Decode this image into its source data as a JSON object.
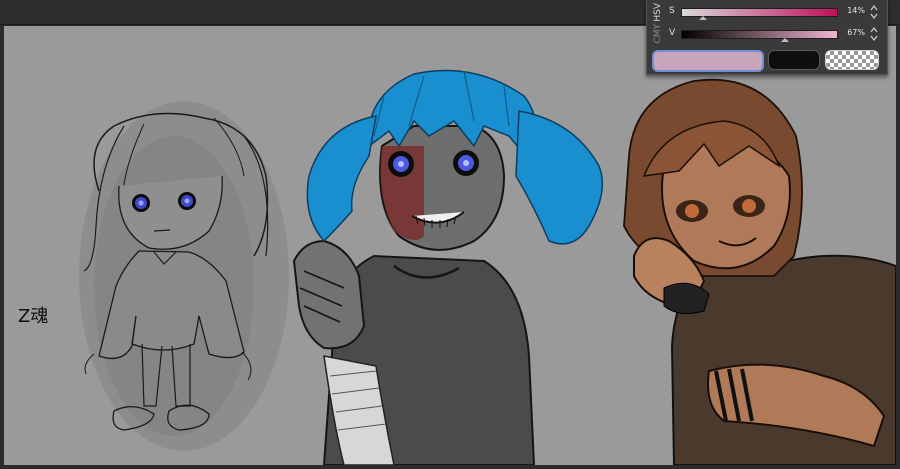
{
  "canvas": {
    "background": "#9a9a9a",
    "signature_text": "Z魂"
  },
  "color_panel": {
    "tabs": [
      {
        "label": "HSV",
        "active": true
      },
      {
        "label": "CMY",
        "active": false
      }
    ],
    "sliders": [
      {
        "letter": "S",
        "value_text": "14%",
        "level": 0.14
      },
      {
        "letter": "V",
        "value_text": "67%",
        "level": 0.67
      }
    ],
    "swatches": {
      "main_color": "#c8a5ba",
      "sub_color": "#0e0e0e",
      "transparent": "transparent"
    }
  },
  "icons": {
    "spinner": "up-down-spinner-icon"
  }
}
